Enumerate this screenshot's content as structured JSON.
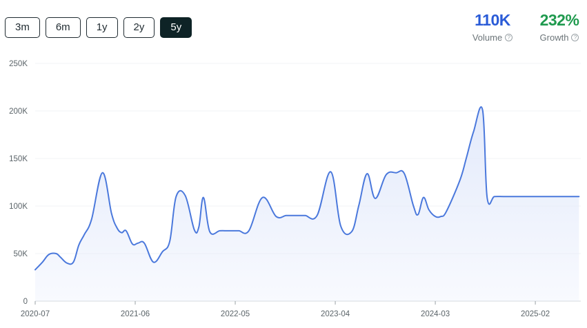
{
  "ranges": [
    "3m",
    "6m",
    "1y",
    "2y",
    "5y"
  ],
  "active_range": "5y",
  "stats": {
    "volume": {
      "value": "110K",
      "label": "Volume",
      "color": "#2a5bd7"
    },
    "growth": {
      "value": "232%",
      "label": "Growth",
      "color": "#1f9a4e"
    },
    "help_glyph": "?"
  },
  "chart_data": {
    "type": "area",
    "title": "",
    "xlabel": "",
    "ylabel": "",
    "ylim": [
      0,
      250000
    ],
    "yticks": [
      0,
      50000,
      100000,
      150000,
      200000,
      250000
    ],
    "ytick_labels": [
      "0",
      "50K",
      "100K",
      "150K",
      "200K",
      "250K"
    ],
    "xtick_labels": [
      "2020-07",
      "2021-06",
      "2022-05",
      "2023-04",
      "2024-03",
      "2025-02"
    ],
    "xtick_positions": [
      0,
      11,
      22,
      33,
      44,
      55
    ],
    "x_range": [
      0,
      60
    ],
    "grid": true,
    "line_color": "#4a78dc",
    "fill_color": "#e3eafb",
    "series": [
      {
        "x": [
          0,
          0.8,
          1.5,
          2.3,
          2.8,
          3.5,
          4.2,
          4.8,
          5.4,
          6.2,
          7.4,
          8.4,
          9,
          9.5,
          10,
          10.7,
          11.3,
          12,
          13,
          14,
          14.8,
          15.5,
          16.5,
          17.5,
          18,
          18.5,
          19.2,
          20.3,
          21.1,
          21.7,
          22.4,
          23.5,
          25,
          26.5,
          27.6,
          28.5,
          29,
          29.7,
          31,
          32.5,
          33.6,
          34.8,
          35.6,
          36.5,
          37.4,
          38.6,
          39.7,
          40.6,
          41.6,
          42.1,
          42.7,
          43.3,
          44,
          44.6,
          45.2,
          46.7,
          47.4,
          48.2,
          49.2,
          49.7,
          50.5,
          51.5,
          52.5,
          53.5,
          54.5,
          55,
          55.8,
          56.5,
          57.3,
          58.5,
          59.8
        ],
        "y": [
          33000,
          41000,
          49000,
          50000,
          46000,
          40000,
          41000,
          59000,
          70000,
          86000,
          135000,
          92000,
          77000,
          72000,
          74000,
          60000,
          61000,
          61000,
          41000,
          52000,
          63000,
          110000,
          111000,
          75000,
          78000,
          109000,
          73000,
          74000,
          74000,
          74000,
          74000,
          74000,
          109000,
          89000,
          90000,
          90000,
          90000,
          90000,
          90000,
          136000,
          79000,
          73000,
          101000,
          134000,
          108000,
          133000,
          135000,
          134000,
          100000,
          91000,
          109000,
          96000,
          89000,
          89000,
          94000,
          127000,
          150000,
          178000,
          201000,
          109000,
          110000,
          110000,
          110000,
          110000,
          110000,
          110000,
          110000,
          110000,
          110000,
          110000,
          110000
        ]
      }
    ]
  }
}
